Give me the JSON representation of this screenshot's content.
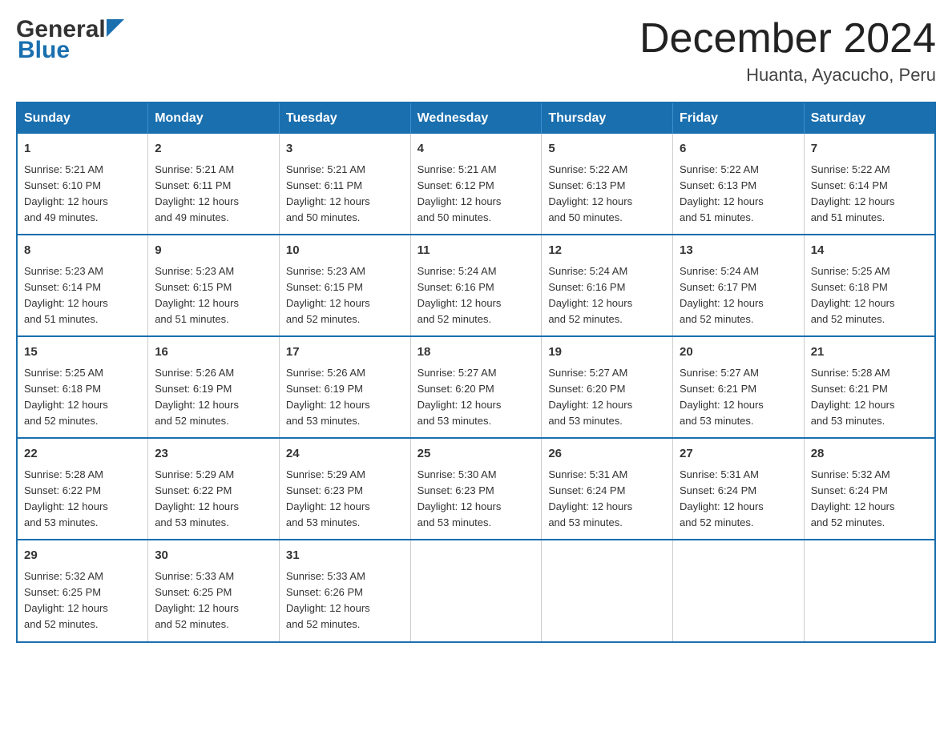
{
  "header": {
    "logo": {
      "general": "General",
      "blue": "Blue"
    },
    "title": "December 2024",
    "location": "Huanta, Ayacucho, Peru"
  },
  "calendar": {
    "days_of_week": [
      "Sunday",
      "Monday",
      "Tuesday",
      "Wednesday",
      "Thursday",
      "Friday",
      "Saturday"
    ],
    "weeks": [
      [
        {
          "day": "1",
          "sunrise": "5:21 AM",
          "sunset": "6:10 PM",
          "daylight": "12 hours and 49 minutes."
        },
        {
          "day": "2",
          "sunrise": "5:21 AM",
          "sunset": "6:11 PM",
          "daylight": "12 hours and 49 minutes."
        },
        {
          "day": "3",
          "sunrise": "5:21 AM",
          "sunset": "6:11 PM",
          "daylight": "12 hours and 50 minutes."
        },
        {
          "day": "4",
          "sunrise": "5:21 AM",
          "sunset": "6:12 PM",
          "daylight": "12 hours and 50 minutes."
        },
        {
          "day": "5",
          "sunrise": "5:22 AM",
          "sunset": "6:13 PM",
          "daylight": "12 hours and 50 minutes."
        },
        {
          "day": "6",
          "sunrise": "5:22 AM",
          "sunset": "6:13 PM",
          "daylight": "12 hours and 51 minutes."
        },
        {
          "day": "7",
          "sunrise": "5:22 AM",
          "sunset": "6:14 PM",
          "daylight": "12 hours and 51 minutes."
        }
      ],
      [
        {
          "day": "8",
          "sunrise": "5:23 AM",
          "sunset": "6:14 PM",
          "daylight": "12 hours and 51 minutes."
        },
        {
          "day": "9",
          "sunrise": "5:23 AM",
          "sunset": "6:15 PM",
          "daylight": "12 hours and 51 minutes."
        },
        {
          "day": "10",
          "sunrise": "5:23 AM",
          "sunset": "6:15 PM",
          "daylight": "12 hours and 52 minutes."
        },
        {
          "day": "11",
          "sunrise": "5:24 AM",
          "sunset": "6:16 PM",
          "daylight": "12 hours and 52 minutes."
        },
        {
          "day": "12",
          "sunrise": "5:24 AM",
          "sunset": "6:16 PM",
          "daylight": "12 hours and 52 minutes."
        },
        {
          "day": "13",
          "sunrise": "5:24 AM",
          "sunset": "6:17 PM",
          "daylight": "12 hours and 52 minutes."
        },
        {
          "day": "14",
          "sunrise": "5:25 AM",
          "sunset": "6:18 PM",
          "daylight": "12 hours and 52 minutes."
        }
      ],
      [
        {
          "day": "15",
          "sunrise": "5:25 AM",
          "sunset": "6:18 PM",
          "daylight": "12 hours and 52 minutes."
        },
        {
          "day": "16",
          "sunrise": "5:26 AM",
          "sunset": "6:19 PM",
          "daylight": "12 hours and 52 minutes."
        },
        {
          "day": "17",
          "sunrise": "5:26 AM",
          "sunset": "6:19 PM",
          "daylight": "12 hours and 53 minutes."
        },
        {
          "day": "18",
          "sunrise": "5:27 AM",
          "sunset": "6:20 PM",
          "daylight": "12 hours and 53 minutes."
        },
        {
          "day": "19",
          "sunrise": "5:27 AM",
          "sunset": "6:20 PM",
          "daylight": "12 hours and 53 minutes."
        },
        {
          "day": "20",
          "sunrise": "5:27 AM",
          "sunset": "6:21 PM",
          "daylight": "12 hours and 53 minutes."
        },
        {
          "day": "21",
          "sunrise": "5:28 AM",
          "sunset": "6:21 PM",
          "daylight": "12 hours and 53 minutes."
        }
      ],
      [
        {
          "day": "22",
          "sunrise": "5:28 AM",
          "sunset": "6:22 PM",
          "daylight": "12 hours and 53 minutes."
        },
        {
          "day": "23",
          "sunrise": "5:29 AM",
          "sunset": "6:22 PM",
          "daylight": "12 hours and 53 minutes."
        },
        {
          "day": "24",
          "sunrise": "5:29 AM",
          "sunset": "6:23 PM",
          "daylight": "12 hours and 53 minutes."
        },
        {
          "day": "25",
          "sunrise": "5:30 AM",
          "sunset": "6:23 PM",
          "daylight": "12 hours and 53 minutes."
        },
        {
          "day": "26",
          "sunrise": "5:31 AM",
          "sunset": "6:24 PM",
          "daylight": "12 hours and 53 minutes."
        },
        {
          "day": "27",
          "sunrise": "5:31 AM",
          "sunset": "6:24 PM",
          "daylight": "12 hours and 52 minutes."
        },
        {
          "day": "28",
          "sunrise": "5:32 AM",
          "sunset": "6:24 PM",
          "daylight": "12 hours and 52 minutes."
        }
      ],
      [
        {
          "day": "29",
          "sunrise": "5:32 AM",
          "sunset": "6:25 PM",
          "daylight": "12 hours and 52 minutes."
        },
        {
          "day": "30",
          "sunrise": "5:33 AM",
          "sunset": "6:25 PM",
          "daylight": "12 hours and 52 minutes."
        },
        {
          "day": "31",
          "sunrise": "5:33 AM",
          "sunset": "6:26 PM",
          "daylight": "12 hours and 52 minutes."
        },
        null,
        null,
        null,
        null
      ]
    ],
    "labels": {
      "sunrise": "Sunrise:",
      "sunset": "Sunset:",
      "daylight": "Daylight:"
    }
  }
}
